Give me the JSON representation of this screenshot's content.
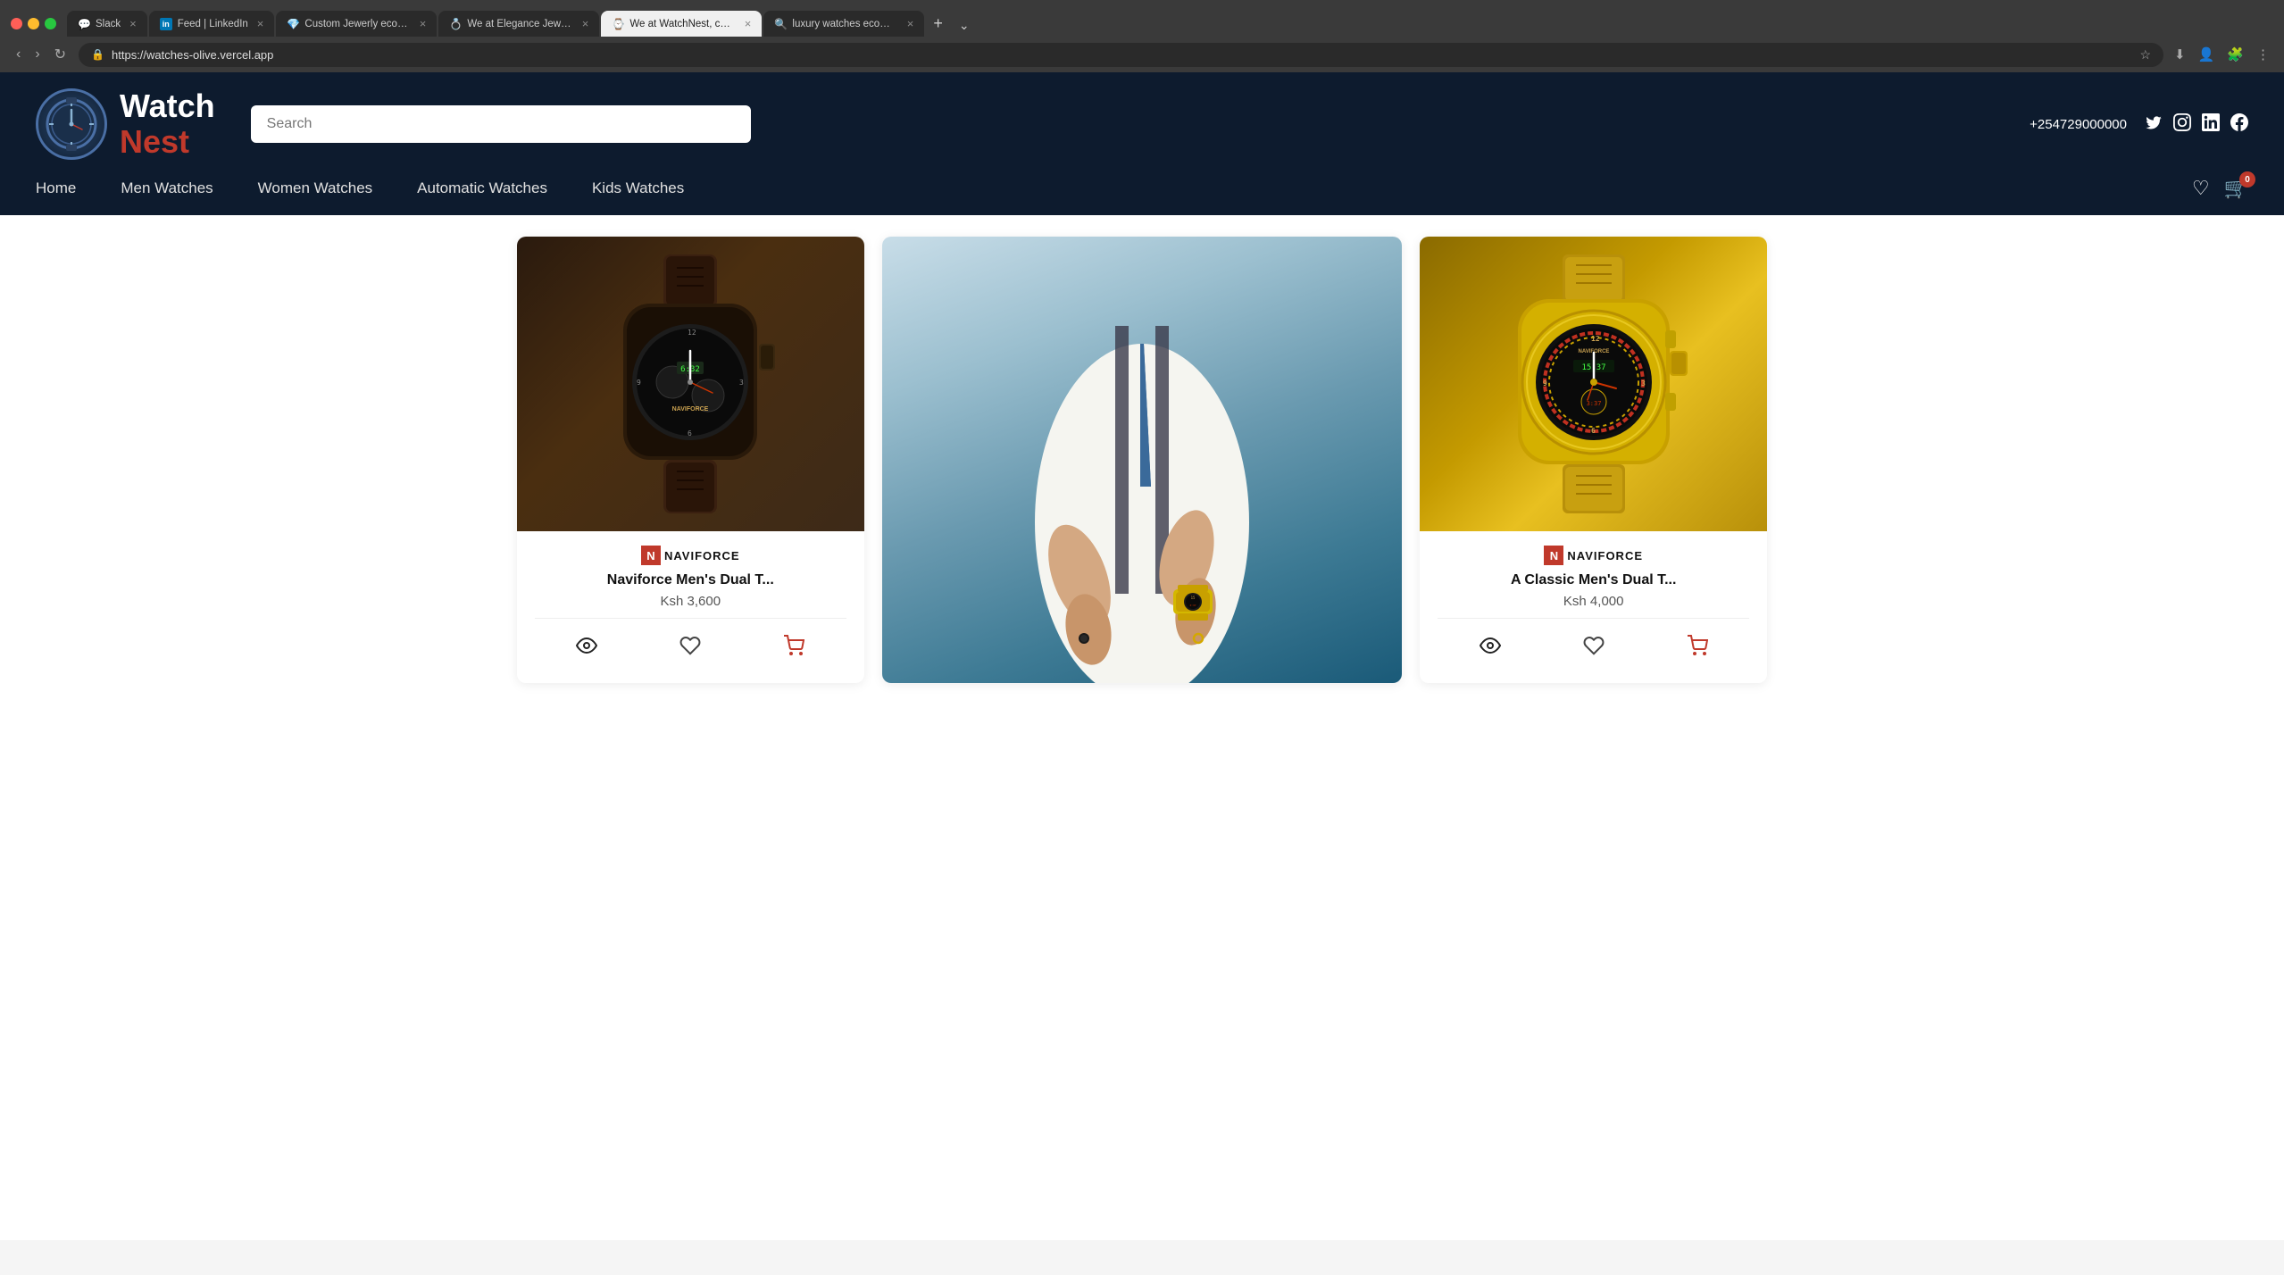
{
  "browser": {
    "url": "https://watches-olive.vercel.app",
    "tabs": [
      {
        "id": "tab-slack",
        "label": "Slack",
        "favicon": "💬",
        "active": false,
        "closeable": true
      },
      {
        "id": "tab-linkedin",
        "label": "Feed | LinkedIn",
        "favicon": "in",
        "active": false,
        "closeable": true
      },
      {
        "id": "tab-custom-jewelry",
        "label": "Custom Jewerly ecomme",
        "favicon": "💎",
        "active": false,
        "closeable": true
      },
      {
        "id": "tab-elegance",
        "label": "We at Elegance Jewerlys",
        "favicon": "💍",
        "active": false,
        "closeable": true
      },
      {
        "id": "tab-watchnest",
        "label": "We at WatchNest, covers",
        "favicon": "⌚",
        "active": true,
        "closeable": true
      },
      {
        "id": "tab-luxury",
        "label": "luxury watches ecomme",
        "favicon": "🔍",
        "active": false,
        "closeable": true
      }
    ],
    "nav_back": "‹",
    "nav_forward": "›",
    "nav_reload": "↻"
  },
  "header": {
    "logo_watch": "Watch",
    "logo_nest": "Nest",
    "search_placeholder": "Search",
    "phone": "+254729000000",
    "social": [
      "twitter",
      "instagram",
      "linkedin",
      "facebook"
    ]
  },
  "nav": {
    "items": [
      "Home",
      "Men Watches",
      "Women Watches",
      "Automatic Watches",
      "Kids Watches"
    ],
    "cart_count": "0"
  },
  "products": [
    {
      "id": "prod-1",
      "brand": "NAVIFORCE",
      "name": "Naviforce Men's Dual T...",
      "price": "Ksh 3,600",
      "image_type": "watch-left"
    },
    {
      "id": "prod-center",
      "brand": "",
      "name": "",
      "price": "",
      "image_type": "watch-center"
    },
    {
      "id": "prod-2",
      "brand": "NAVIFORCE",
      "name": "A Classic Men's Dual T...",
      "price": "Ksh 4,000",
      "image_type": "watch-right"
    }
  ],
  "actions": {
    "view": "👁",
    "wish": "♡",
    "cart": "🛒"
  }
}
